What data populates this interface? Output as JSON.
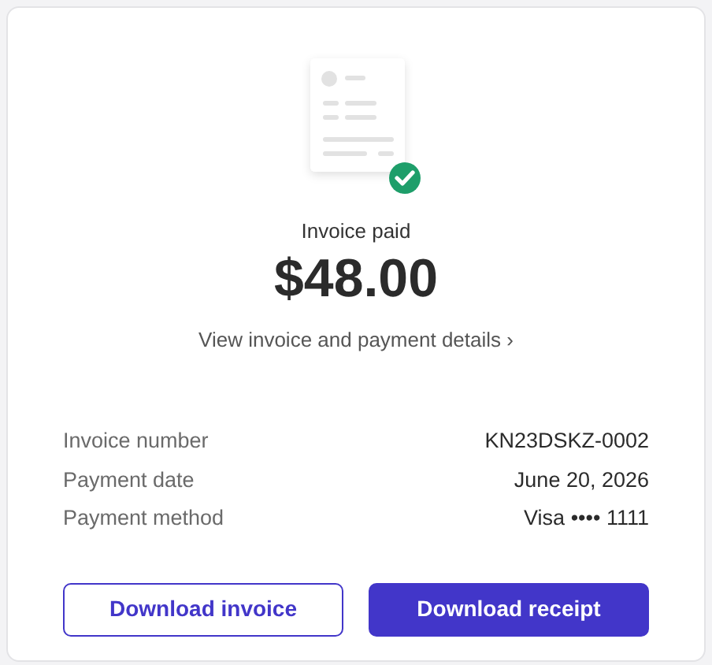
{
  "status": "Invoice paid",
  "amount": "$48.00",
  "details_link": "View invoice and payment details",
  "details_chevron": "›",
  "rows": [
    {
      "label": "Invoice number",
      "value": "KN23DSKZ-0002"
    },
    {
      "label": "Payment date",
      "value": "June 20, 2026"
    },
    {
      "label": "Payment method",
      "value": "Visa •••• 1111"
    }
  ],
  "buttons": [
    {
      "label": "Download invoice",
      "kind": "outline"
    },
    {
      "label": "Download receipt",
      "kind": "filled"
    }
  ]
}
